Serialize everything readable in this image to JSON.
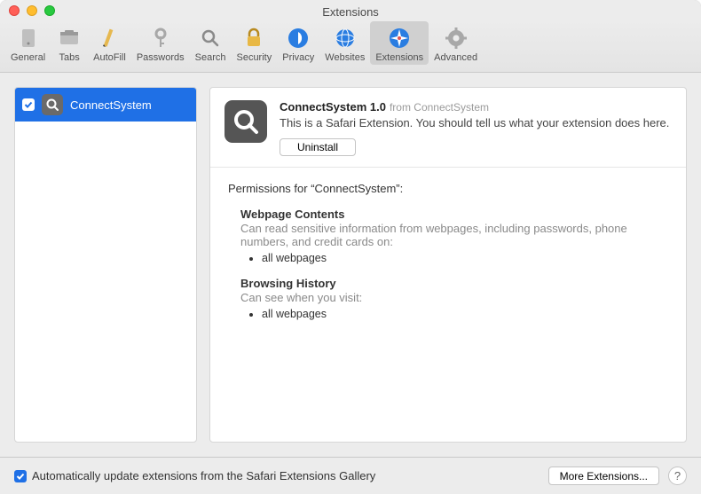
{
  "window": {
    "title": "Extensions"
  },
  "toolbar": {
    "items": [
      {
        "label": "General"
      },
      {
        "label": "Tabs"
      },
      {
        "label": "AutoFill"
      },
      {
        "label": "Passwords"
      },
      {
        "label": "Search"
      },
      {
        "label": "Security"
      },
      {
        "label": "Privacy"
      },
      {
        "label": "Websites"
      },
      {
        "label": "Extensions"
      },
      {
        "label": "Advanced"
      }
    ]
  },
  "sidebar": {
    "selected": {
      "label": "ConnectSystem",
      "checked": true
    }
  },
  "extension": {
    "name": "ConnectSystem",
    "version": "1.0",
    "from_prefix": "from",
    "from_name": "ConnectSystem",
    "description": "This is a Safari Extension. You should tell us what your extension does here.",
    "uninstall": "Uninstall"
  },
  "permissions": {
    "title": "Permissions for “ConnectSystem”:",
    "sections": [
      {
        "head": "Webpage Contents",
        "desc": "Can read sensitive information from webpages, including passwords, phone numbers, and credit cards on:",
        "item": "all webpages"
      },
      {
        "head": "Browsing History",
        "desc": "Can see when you visit:",
        "item": "all webpages"
      }
    ]
  },
  "footer": {
    "auto_update": "Automatically update extensions from the Safari Extensions Gallery",
    "more": "More Extensions...",
    "help": "?"
  }
}
